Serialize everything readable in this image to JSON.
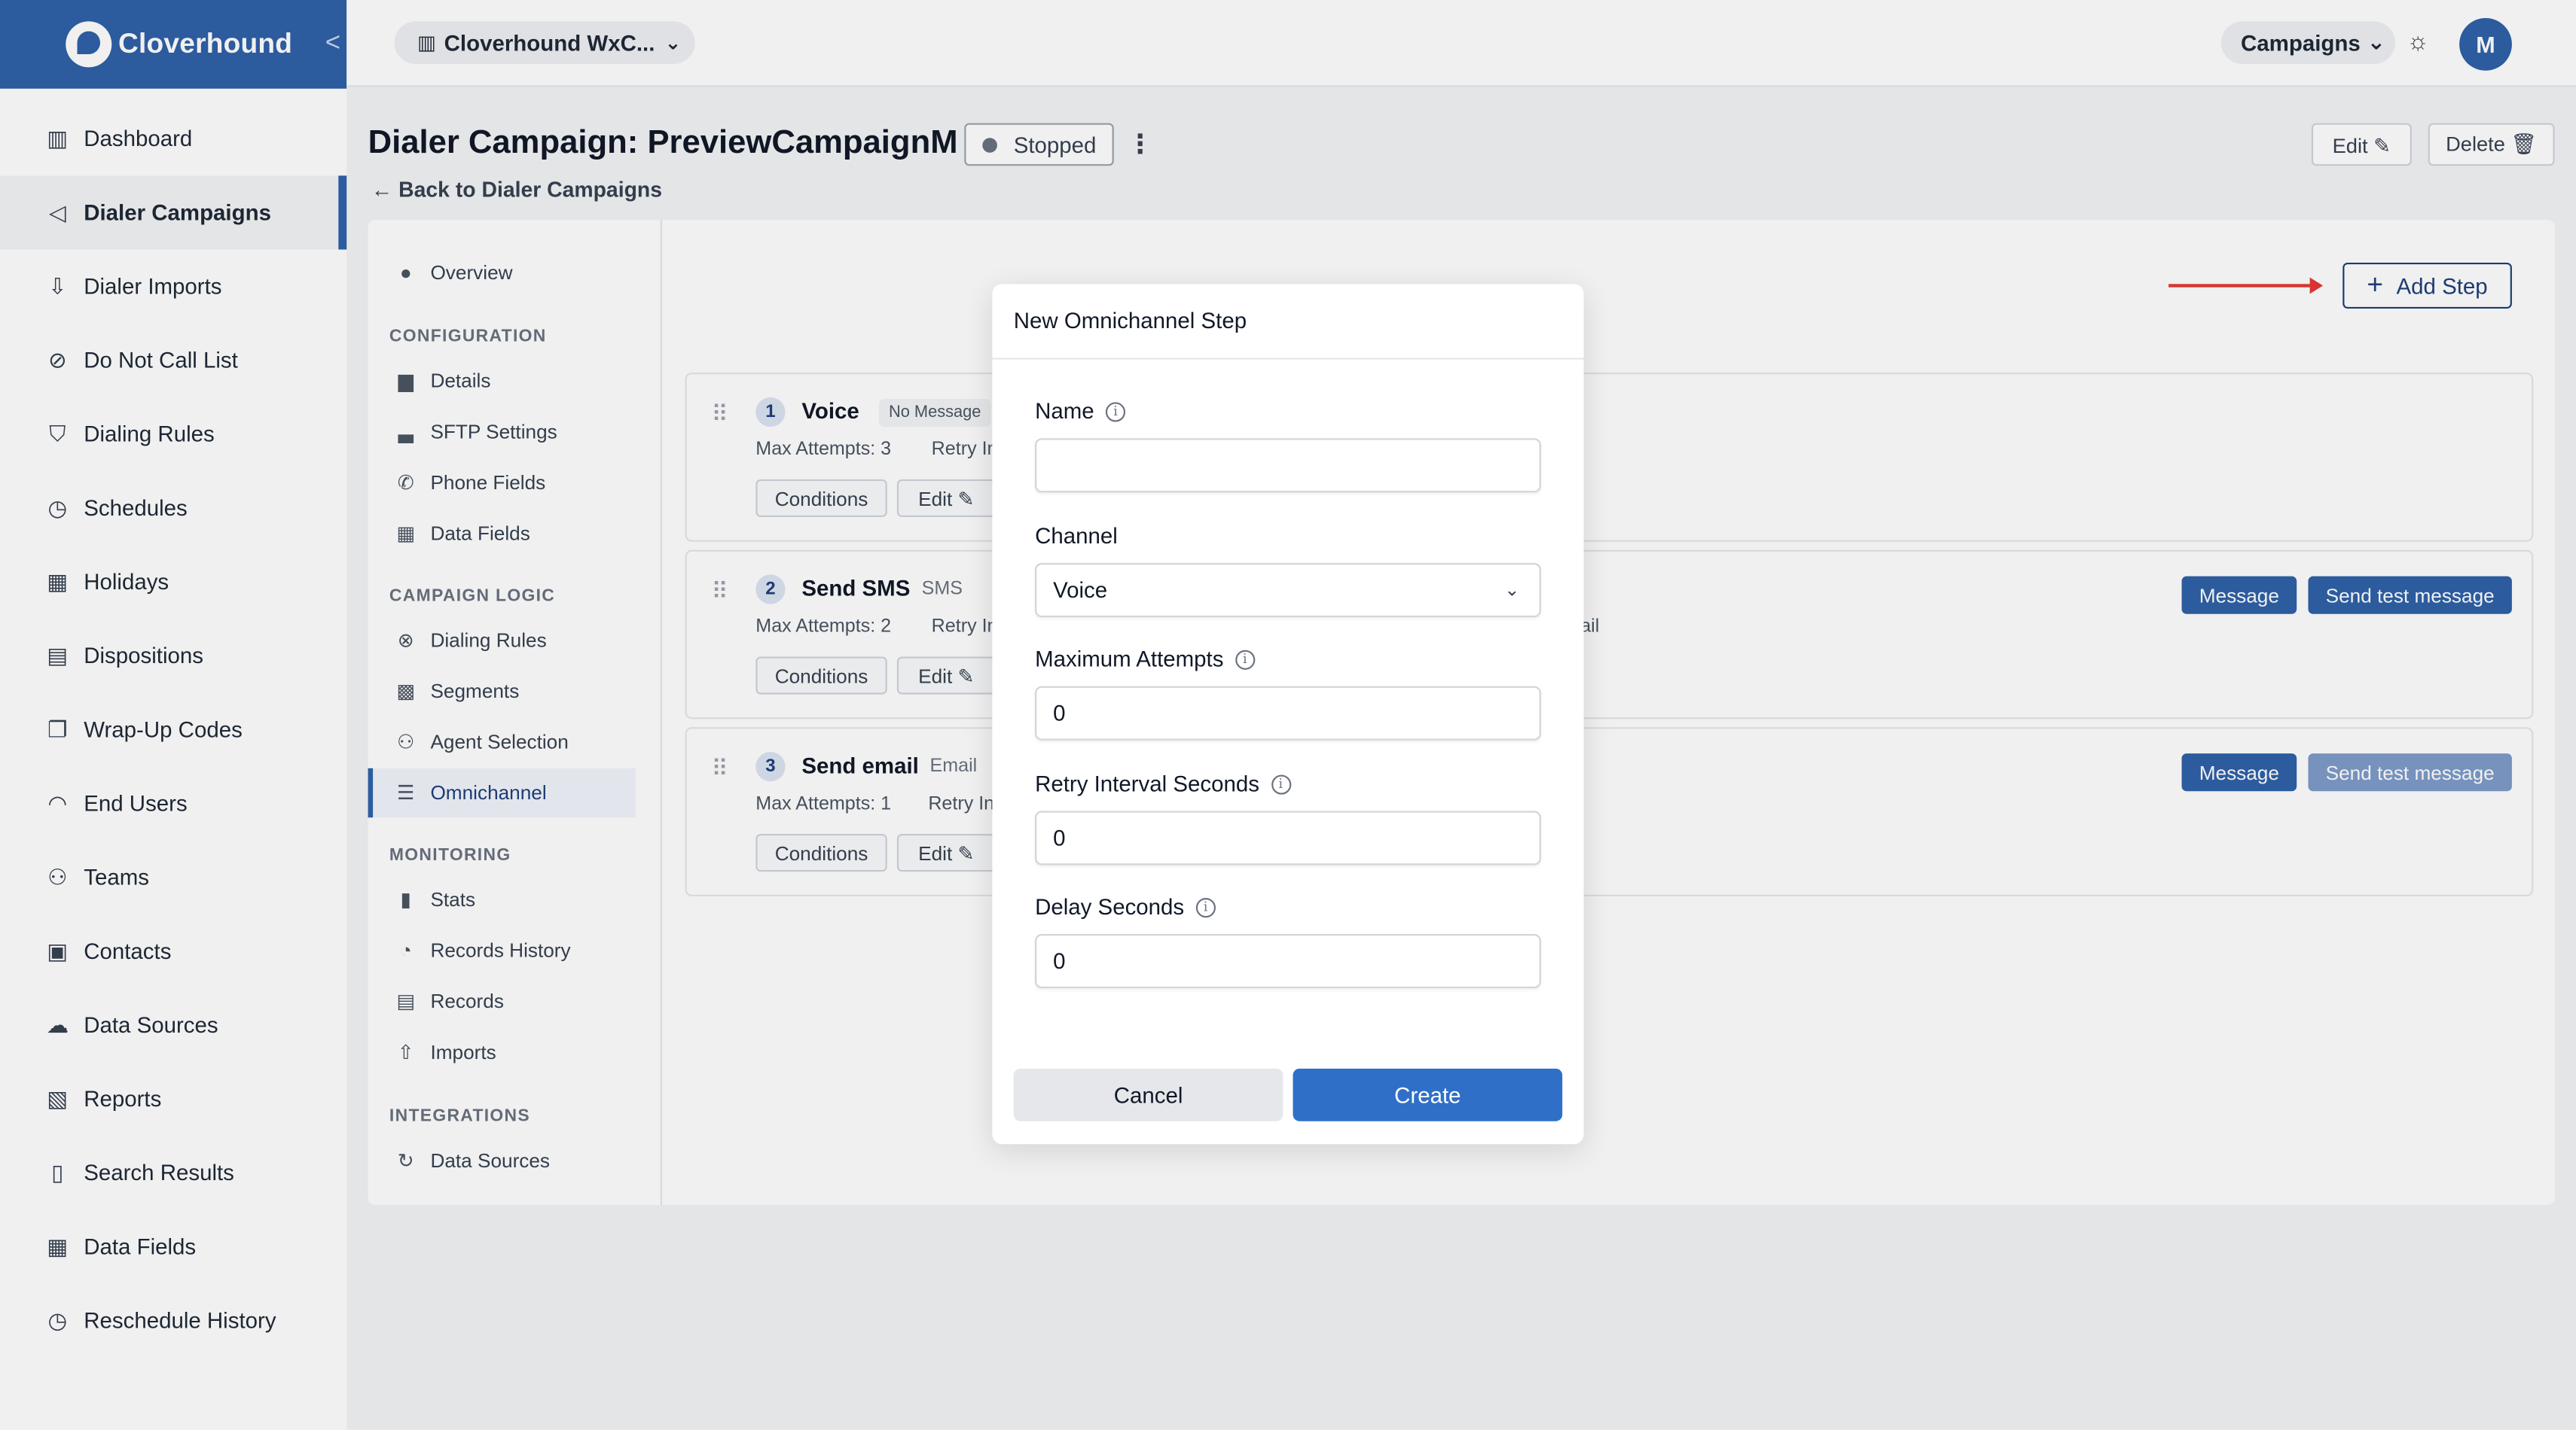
{
  "brand": {
    "name": "Cloverhound",
    "collapse_glyph": "<"
  },
  "sidebar": {
    "items": [
      {
        "label": "Dashboard",
        "icon": "bar-chart-icon",
        "glyph": "▥"
      },
      {
        "label": "Dialer Campaigns",
        "icon": "megaphone-icon",
        "glyph": "◁"
      },
      {
        "label": "Dialer Imports",
        "icon": "import-icon",
        "glyph": "⇩"
      },
      {
        "label": "Do Not Call List",
        "icon": "prohibited-icon",
        "glyph": "⊘"
      },
      {
        "label": "Dialing Rules",
        "icon": "shield-icon",
        "glyph": "⛉"
      },
      {
        "label": "Schedules",
        "icon": "clock-icon",
        "glyph": "◷"
      },
      {
        "label": "Holidays",
        "icon": "calendar-icon",
        "glyph": "▦"
      },
      {
        "label": "Dispositions",
        "icon": "clipboard-icon",
        "glyph": "▤"
      },
      {
        "label": "Wrap-Up Codes",
        "icon": "copy-icon",
        "glyph": "❐"
      },
      {
        "label": "End Users",
        "icon": "headset-icon",
        "glyph": "◠"
      },
      {
        "label": "Teams",
        "icon": "users-icon",
        "glyph": "⚇"
      },
      {
        "label": "Contacts",
        "icon": "address-card-icon",
        "glyph": "▣"
      },
      {
        "label": "Data Sources",
        "icon": "cloud-icon",
        "glyph": "☁"
      },
      {
        "label": "Reports",
        "icon": "report-icon",
        "glyph": "▧"
      },
      {
        "label": "Search Results",
        "icon": "search-file-icon",
        "glyph": "▯"
      },
      {
        "label": "Data Fields",
        "icon": "table-icon",
        "glyph": "▦"
      },
      {
        "label": "Reschedule History",
        "icon": "history-icon",
        "glyph": "◷"
      }
    ],
    "active_index": 1
  },
  "topbar": {
    "org_name": "Cloverhound WxC...",
    "org_icon_glyph": "▥",
    "campaigns_label": "Campaigns",
    "chevron_glyph": "⌄",
    "sun_glyph": "☼",
    "avatar_initial": "M"
  },
  "header": {
    "title": "Dialer Campaign: PreviewCampaignM",
    "status": "Stopped",
    "kebab_glyph": "⋮",
    "back_label": "← Back to Dialer Campaigns",
    "edit_label": "Edit ✎",
    "delete_label": "Delete 🗑"
  },
  "subnav": {
    "overview": "Overview",
    "sections": [
      {
        "heading": "CONFIGURATION",
        "items": [
          "Details",
          "SFTP Settings",
          "Phone Fields",
          "Data Fields"
        ]
      },
      {
        "heading": "CAMPAIGN LOGIC",
        "items": [
          "Dialing Rules",
          "Segments",
          "Agent Selection",
          "Omnichannel"
        ]
      },
      {
        "heading": "MONITORING",
        "items": [
          "Stats",
          "Records History",
          "Records",
          "Imports"
        ]
      },
      {
        "heading": "INTEGRATIONS",
        "items": [
          "Data Sources"
        ]
      }
    ],
    "glyphs": {
      "overview": "●",
      "details": "▆",
      "sftp": "▃",
      "phone": "✆",
      "datafields": "▦",
      "dialingrules": "⊗",
      "segments": "▩",
      "agent": "⚇",
      "omni": "☰",
      "stats": "▮",
      "history": "◔",
      "records": "▤",
      "imports": "⇧",
      "datasources": "↻"
    }
  },
  "main": {
    "add_step_label": "Add Step",
    "add_step_glyph": "+",
    "grip_glyph": "⠿",
    "steps": [
      {
        "num": "1",
        "name": "Voice",
        "type": "",
        "tag": "No Message",
        "max_attempts": "Max Attempts: 3",
        "retry": "Retry In",
        "conditions": "Conditions",
        "edit": "Edit ✎"
      },
      {
        "num": "2",
        "name": "Send SMS",
        "type": "SMS",
        "tag": "",
        "max_attempts": "Max Attempts: 2",
        "retry": "Retry In",
        "conditions": "Conditions",
        "edit": "Edit ✎",
        "message": "Message",
        "send_test": "Send test message",
        "trail": "ail"
      },
      {
        "num": "3",
        "name": "Send email",
        "type": "Email",
        "tag": "",
        "max_attempts": "Max Attempts: 1",
        "retry": "Retry In",
        "conditions": "Conditions",
        "edit": "Edit ✎",
        "message": "Message",
        "send_test": "Send test message"
      }
    ]
  },
  "modal": {
    "title": "New Omnichannel Step",
    "info_glyph": "i",
    "name_label": "Name",
    "name_value": "",
    "channel_label": "Channel",
    "channel_value": "Voice",
    "max_attempts_label": "Maximum Attempts",
    "max_attempts_value": "0",
    "retry_label": "Retry Interval Seconds",
    "retry_value": "0",
    "delay_label": "Delay Seconds",
    "delay_value": "0",
    "cancel_label": "Cancel",
    "create_label": "Create"
  },
  "colors": {
    "brand": "#2f61a8",
    "primary_button": "#2f6fc8",
    "arrow": "#e53935"
  }
}
